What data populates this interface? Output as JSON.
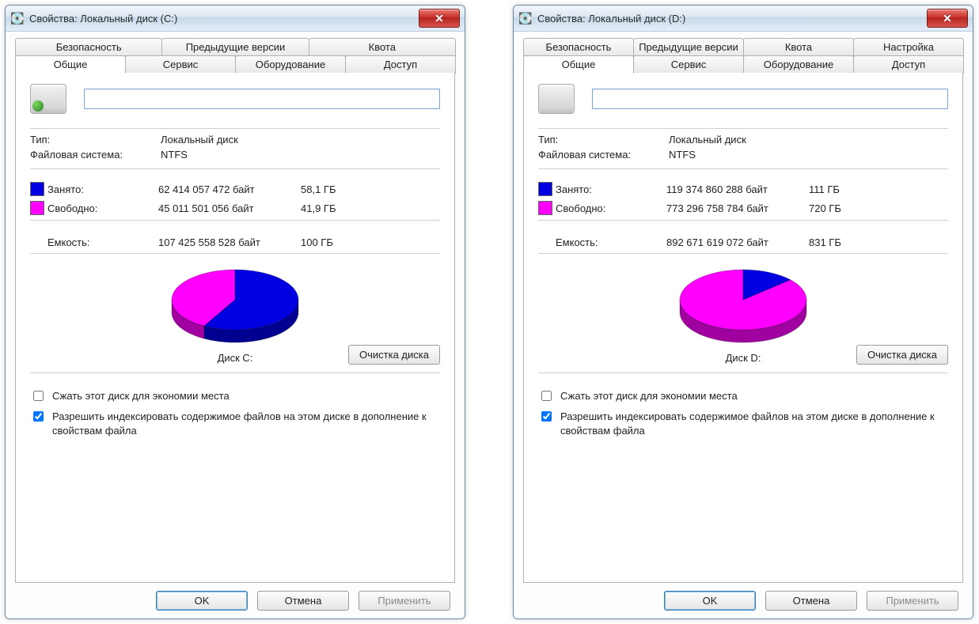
{
  "windows": [
    {
      "title": "Свойства: Локальный диск (C:)",
      "drive_accent": true,
      "tabs_row1": [
        "Безопасность",
        "Предыдущие версии",
        "Квота"
      ],
      "tabs_row2": [
        "Общие",
        "Сервис",
        "Оборудование",
        "Доступ"
      ],
      "active_tab": "Общие",
      "name_value": "",
      "type_label": "Тип:",
      "type_value": "Локальный диск",
      "fs_label": "Файловая система:",
      "fs_value": "NTFS",
      "used_label": "Занято:",
      "used_bytes": "62 414 057 472 байт",
      "used_h": "58,1 ГБ",
      "free_label": "Свободно:",
      "free_bytes": "45 011 501 056 байт",
      "free_h": "41,9 ГБ",
      "cap_label": "Емкость:",
      "cap_bytes": "107 425 558 528 байт",
      "cap_h": "100 ГБ",
      "disk_label": "Диск C:",
      "cleanup_label": "Очистка диска",
      "compress_label": "Сжать этот диск для экономии места",
      "compress_checked": false,
      "index_label": "Разрешить индексировать содержимое файлов на этом диске в дополнение к свойствам файла",
      "index_checked": true,
      "ok": "OK",
      "cancel": "Отмена",
      "apply": "Применить",
      "used_fraction": 0.581
    },
    {
      "title": "Свойства: Локальный диск (D:)",
      "drive_accent": false,
      "tabs_row1": [
        "Безопасность",
        "Предыдущие версии",
        "Квота",
        "Настройка"
      ],
      "tabs_row2": [
        "Общие",
        "Сервис",
        "Оборудование",
        "Доступ"
      ],
      "active_tab": "Общие",
      "name_value": "",
      "type_label": "Тип:",
      "type_value": "Локальный диск",
      "fs_label": "Файловая система:",
      "fs_value": "NTFS",
      "used_label": "Занято:",
      "used_bytes": "119 374 860 288 байт",
      "used_h": "111 ГБ",
      "free_label": "Свободно:",
      "free_bytes": "773 296 758 784 байт",
      "free_h": "720 ГБ",
      "cap_label": "Емкость:",
      "cap_bytes": "892 671 619 072 байт",
      "cap_h": "831 ГБ",
      "disk_label": "Диск D:",
      "cleanup_label": "Очистка диска",
      "compress_label": "Сжать этот диск для экономии места",
      "compress_checked": false,
      "index_label": "Разрешить индексировать содержимое файлов на этом диске в дополнение к свойствам файла",
      "index_checked": true,
      "ok": "OK",
      "cancel": "Отмена",
      "apply": "Применить",
      "used_fraction": 0.134
    }
  ],
  "chart_data": [
    {
      "type": "pie",
      "title": "Диск C:",
      "series": [
        {
          "name": "Занято",
          "value": 62414057472,
          "fraction": 0.581,
          "color": "#0000e0"
        },
        {
          "name": "Свободно",
          "value": 45011501056,
          "fraction": 0.419,
          "color": "#ff00ff"
        }
      ]
    },
    {
      "type": "pie",
      "title": "Диск D:",
      "series": [
        {
          "name": "Занято",
          "value": 119374860288,
          "fraction": 0.134,
          "color": "#0000e0"
        },
        {
          "name": "Свободно",
          "value": 773296758784,
          "fraction": 0.866,
          "color": "#ff00ff"
        }
      ]
    }
  ]
}
